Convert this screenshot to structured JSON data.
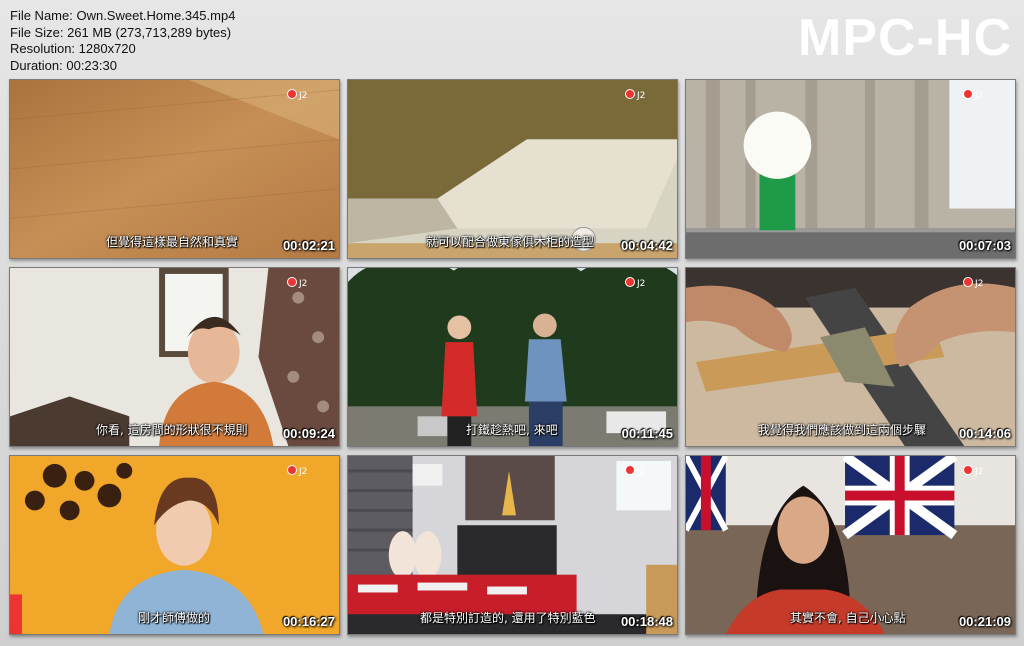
{
  "file_info": {
    "name": "File Name: Own.Sweet.Home.345.mp4",
    "size": "File Size: 261 MB (273,713,289 bytes)",
    "resolution": "Resolution: 1280x720",
    "duration": "Duration: 00:23:30"
  },
  "brand": "MPC-HC",
  "thumbnails": [
    {
      "timestamp": "00:02:21",
      "subtitle": "但覺得這樣最自然和真實"
    },
    {
      "timestamp": "00:04:42",
      "subtitle": "就可以配合做東傢俱木柜的造型"
    },
    {
      "timestamp": "00:07:03",
      "subtitle": ""
    },
    {
      "timestamp": "00:09:24",
      "subtitle": "你看, 這房間的形狀很不規則"
    },
    {
      "timestamp": "00:11:45",
      "subtitle": "打鐵趁熱吧, 來吧"
    },
    {
      "timestamp": "00:14:06",
      "subtitle": "我覺得我們應該做到這兩個步驟"
    },
    {
      "timestamp": "00:16:27",
      "subtitle": "剛才師傅做的"
    },
    {
      "timestamp": "00:18:48",
      "subtitle": "都是特別訂造的, 還用了特別藍色"
    },
    {
      "timestamp": "00:21:09",
      "subtitle": "其實不會, 自己小心點"
    }
  ]
}
